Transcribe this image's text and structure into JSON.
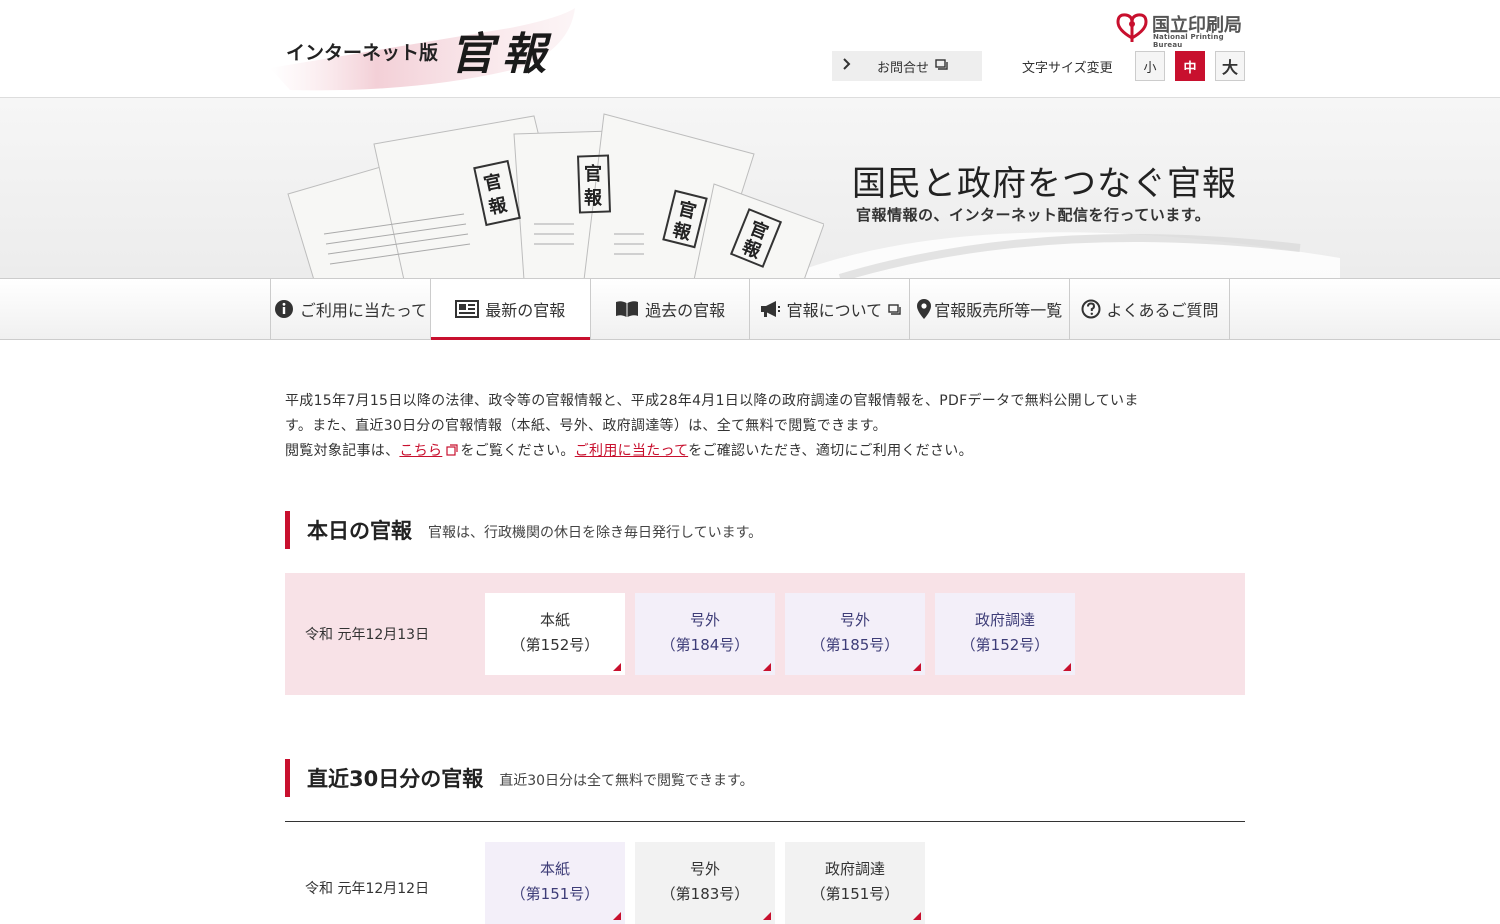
{
  "header": {
    "logo_small": "インターネット版",
    "logo_big": "官報",
    "org_name": "国立印刷局",
    "org_name_en": "National Printing Bureau",
    "contact_label": "お問合せ",
    "font_size_label": "文字サイズ変更",
    "font_sizes": [
      "小",
      "中",
      "大"
    ],
    "font_size_active": "中"
  },
  "hero": {
    "title": "国民と政府をつなぐ官報",
    "subtitle": "官報情報の、インターネット配信を行っています。"
  },
  "nav": {
    "items": [
      {
        "label": "ご利用に当たって",
        "icon": "info-icon"
      },
      {
        "label": "最新の官報",
        "icon": "newspaper-icon"
      },
      {
        "label": "過去の官報",
        "icon": "book-icon"
      },
      {
        "label": "官報について",
        "icon": "megaphone-icon"
      },
      {
        "label": "官報販売所等一覧",
        "icon": "map-pin-icon"
      },
      {
        "label": "よくあるご質問",
        "icon": "question-icon"
      }
    ],
    "active": "最新の官報"
  },
  "intro": {
    "line1": "平成15年7月15日以降の法律、政令等の官報情報と、平成28年4月1日以降の政府調達の官報情報を、PDFデータで無料公開していま",
    "line2": "す。また、直近30日分の官報情報（本紙、号外、政府調達等）は、全て無料で閲覧できます。",
    "line3_pre": "閲覧対象記事は、",
    "line3_link1": "こちら",
    "line3_mid": "をご覧ください。",
    "line3_link2": "ご利用に当たって",
    "line3_post": "をご確認いただき、適切にご利用ください。"
  },
  "today": {
    "title": "本日の官報",
    "subtitle": "官報は、行政機関の休日を除き毎日発行しています。",
    "date": "令和 元年12月13日",
    "issues": [
      {
        "name": "本紙",
        "no": "（第152号）"
      },
      {
        "name": "号外",
        "no": "（第184号）"
      },
      {
        "name": "号外",
        "no": "（第185号）"
      },
      {
        "name": "政府調達",
        "no": "（第152号）"
      }
    ]
  },
  "recent": {
    "title": "直近30日分の官報",
    "subtitle": "直近30日分は全て無料で閲覧できます。",
    "date": "令和 元年12月12日",
    "issues": [
      {
        "name": "本紙",
        "no": "（第151号）"
      },
      {
        "name": "号外",
        "no": "（第183号）"
      },
      {
        "name": "政府調達",
        "no": "（第151号）"
      }
    ]
  },
  "colors": {
    "accent": "#c8102e",
    "today_bg": "#f8e2e7",
    "issue_lavender": "#f3eff9"
  }
}
